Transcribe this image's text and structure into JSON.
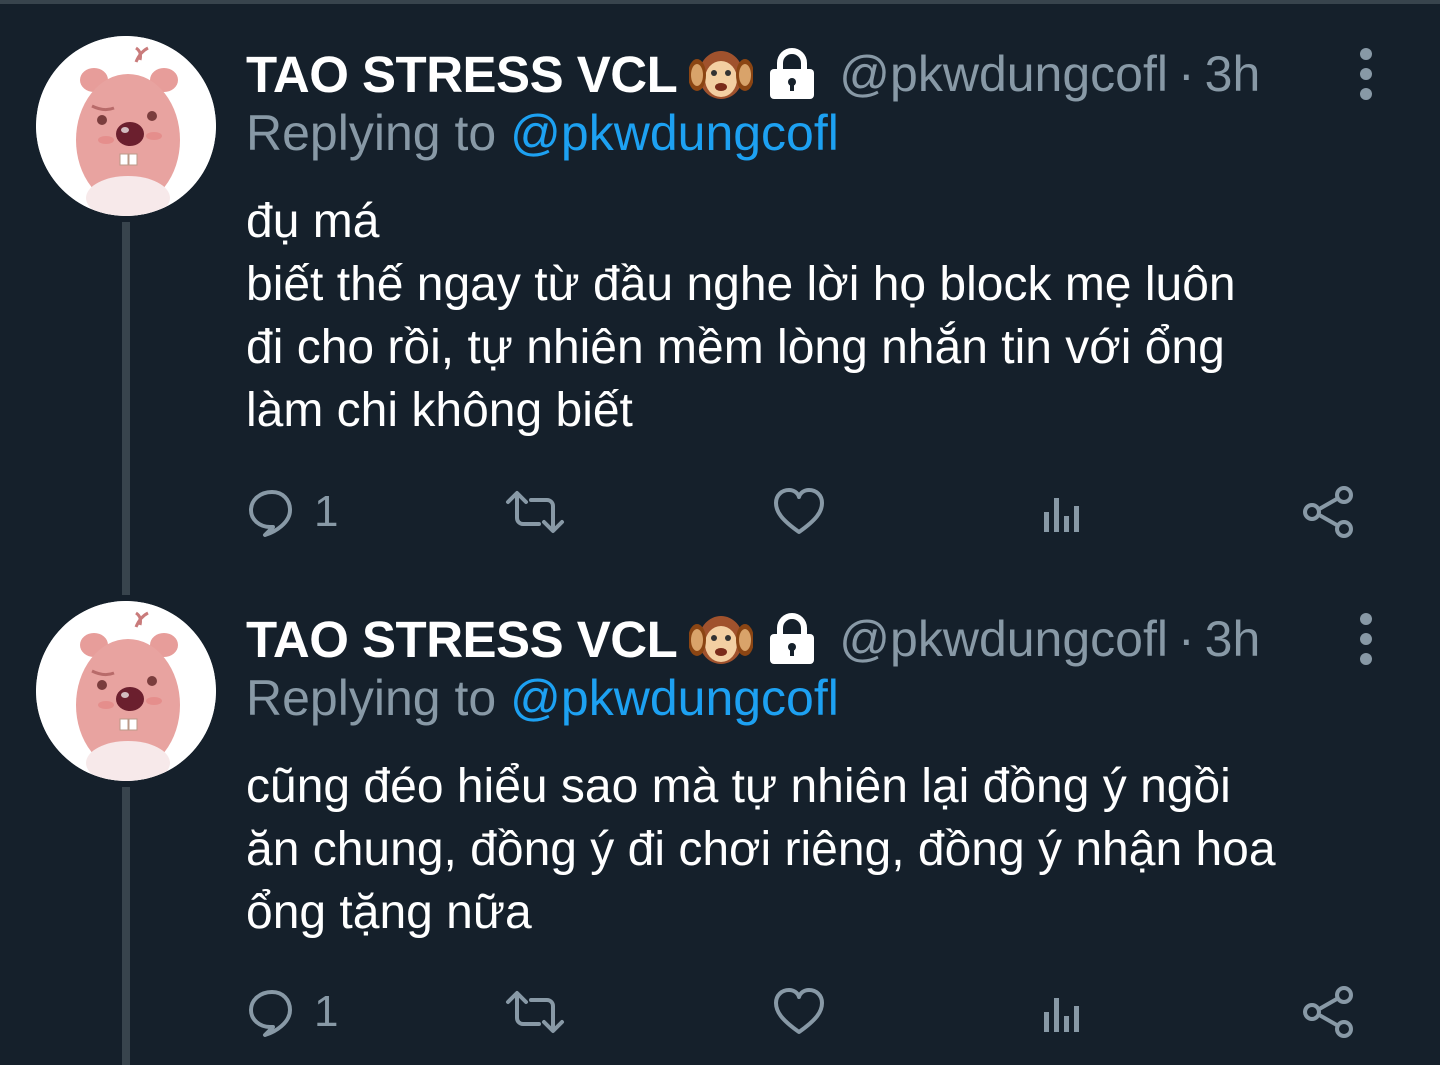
{
  "colors": {
    "background": "#15202b",
    "text_primary": "#ffffff",
    "text_secondary": "#8899a6",
    "accent": "#1da1f2",
    "divider": "#38444d"
  },
  "tweets": [
    {
      "author": {
        "display_name": "TAO STRESS VCL",
        "emoji": "🙉",
        "protected_icon": "lock-icon",
        "handle": "@pkwdungcofl"
      },
      "separator": "·",
      "time": "3h",
      "reply": {
        "prefix": "Replying to",
        "handle": "@pkwdungcofl"
      },
      "text_lines": [
        "đụ má",
        "biết thế ngay từ đầu nghe lời họ block mẹ luôn",
        "đi cho rồi, tự nhiên mềm lòng nhắn tin với ổng",
        "làm chi không biết"
      ],
      "actions": {
        "reply_icon": "reply-icon",
        "reply_count": "1",
        "retweet_icon": "retweet-icon",
        "like_icon": "heart-icon",
        "analytics_icon": "analytics-icon",
        "share_icon": "share-icon"
      }
    },
    {
      "author": {
        "display_name": "TAO STRESS VCL",
        "emoji": "🙉",
        "protected_icon": "lock-icon",
        "handle": "@pkwdungcofl"
      },
      "separator": "·",
      "time": "3h",
      "reply": {
        "prefix": "Replying to",
        "handle": "@pkwdungcofl"
      },
      "text_lines": [
        "cũng đéo hiểu sao mà tự nhiên lại đồng ý ngồi",
        "ăn chung, đồng ý đi chơi riêng, đồng ý nhận hoa",
        "ổng tặng nữa"
      ],
      "actions": {
        "reply_icon": "reply-icon",
        "reply_count": "1",
        "retweet_icon": "retweet-icon",
        "like_icon": "heart-icon",
        "analytics_icon": "analytics-icon",
        "share_icon": "share-icon"
      }
    }
  ]
}
